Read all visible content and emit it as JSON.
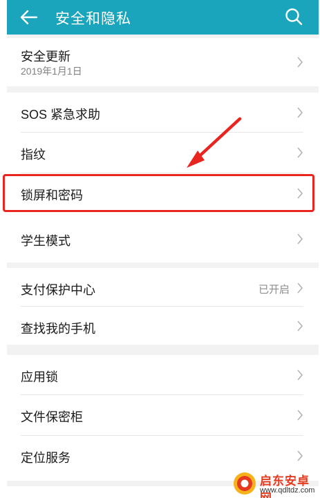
{
  "header": {
    "title": "安全和隐私",
    "back_icon": "arrow-left-icon",
    "search_icon": "search-icon",
    "bar_color": "#1aa5bd"
  },
  "sections": [
    {
      "items": [
        {
          "label": "安全更新",
          "sublabel": "2019年1月1日"
        }
      ]
    },
    {
      "items": [
        {
          "label": "SOS 紧急求助"
        },
        {
          "label": "指纹"
        },
        {
          "label": "锁屏和密码",
          "highlighted": true
        },
        {
          "label": "学生模式"
        }
      ]
    },
    {
      "items": [
        {
          "label": "支付保护中心",
          "value": "已开启"
        },
        {
          "label": "查找我的手机"
        }
      ]
    },
    {
      "items": [
        {
          "label": "应用锁"
        },
        {
          "label": "文件保密柜"
        },
        {
          "label": "定位服务"
        }
      ]
    }
  ],
  "annotation": {
    "color": "#e8251f"
  },
  "watermark": {
    "name": "启东安卓网",
    "url": "www.qdltdz.com"
  }
}
